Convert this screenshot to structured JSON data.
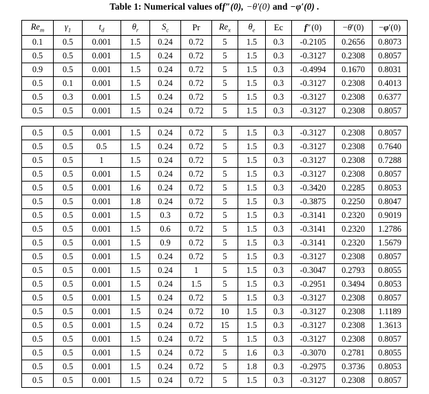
{
  "caption": {
    "lead": "Table 1: Numerical values of",
    "term1": "f″(0),",
    "term2": "−θ′(0)",
    "conj": "and",
    "term3": "−φ′(0) ."
  },
  "table": {
    "columns": [
      {
        "key": "Re_m",
        "base": "Re",
        "sub": "m",
        "style": "italic-sub"
      },
      {
        "key": "gamma1",
        "base": "γ",
        "sub": "1",
        "style": "italic-sub"
      },
      {
        "key": "t_d",
        "base": "t",
        "sub": "d",
        "style": "italic-sub"
      },
      {
        "key": "theta_r",
        "base": "θ",
        "sub": "r",
        "style": "italic-sub"
      },
      {
        "key": "S_c",
        "base": "S",
        "sub": "c",
        "style": "italic-sub"
      },
      {
        "key": "Pr",
        "base": "Pr",
        "sub": "",
        "style": "upright"
      },
      {
        "key": "Re_x",
        "base": "Re",
        "sub": "x",
        "style": "italic-sub"
      },
      {
        "key": "theta_e",
        "base": "θ",
        "sub": "e",
        "style": "italic-sub"
      },
      {
        "key": "Ec",
        "base": "Ec",
        "sub": "",
        "style": "upright"
      },
      {
        "key": "f2_0",
        "base": "f″(0)",
        "sub": "",
        "style": "math"
      },
      {
        "key": "mth_0",
        "base": "−θ′(0)",
        "sub": "",
        "style": "math"
      },
      {
        "key": "mph_0",
        "base": "−φ′(0)",
        "sub": "",
        "style": "math"
      }
    ],
    "header_labels": [
      "Re_m",
      "γ_1",
      "t_d",
      "θ_r",
      "S_c",
      "Pr",
      "Re_x",
      "θ_e",
      "Ec",
      "f″(0)",
      "−θ′(0)",
      "−φ′(0)"
    ],
    "block1_rows": [
      {
        "cells": [
          "0.1",
          "0.5",
          "0.001",
          "1.5",
          "0.24",
          "0.72",
          "5",
          "1.5",
          "0.3",
          "-0.2105",
          "0.2656",
          "0.8073"
        ],
        "align": [
          "c",
          "c",
          "c",
          "c",
          "c",
          "c",
          "c",
          "c",
          "c",
          "c",
          "c",
          "c"
        ]
      },
      {
        "cells": [
          "0.5",
          "0.5",
          "0.001",
          "1.5",
          "0.24",
          "0.72",
          "5",
          "1.5",
          "0.3",
          "-0.3127",
          "0.2308",
          "0.8057"
        ],
        "align": [
          "c",
          "c",
          "c",
          "c",
          "c",
          "c",
          "c",
          "c",
          "c",
          "c",
          "c",
          "c"
        ]
      },
      {
        "cells": [
          "0.9",
          "0.5",
          "0.001",
          "1.5",
          "0.24",
          "0.72",
          "5",
          "1.5",
          "0.3",
          "-0.4994",
          "0.1670",
          "0.8031"
        ],
        "align": [
          "c",
          "c",
          "c",
          "c",
          "c",
          "c",
          "c",
          "c",
          "c",
          "c",
          "c",
          "c"
        ]
      },
      {
        "cells": [
          "0.5",
          "0.1",
          "0.001",
          "1.5",
          "0.24",
          "0.72",
          "5",
          "1.5",
          "0.3",
          "-0.3127",
          "0.2308",
          "0.4013"
        ],
        "align": [
          "c",
          "c",
          "c",
          "c",
          "c",
          "c",
          "c",
          "c",
          "c",
          "c",
          "c",
          "c"
        ]
      },
      {
        "cells": [
          "0.5",
          "0.3",
          "0.001",
          "1.5",
          "0.24",
          "0.72",
          "5",
          "1.5",
          "0.3",
          "-0.3127",
          "0.2308",
          "0.6377"
        ],
        "align": [
          "c",
          "c",
          "c",
          "c",
          "c",
          "c",
          "c",
          "c",
          "c",
          "c",
          "c",
          "c"
        ]
      },
      {
        "cells": [
          "0.5",
          "0.5",
          "0.001",
          "1.5",
          "0.24",
          "0.72",
          "5",
          "1.5",
          "0.3",
          "-0.3127",
          "0.2308",
          "0.8057"
        ],
        "align": [
          "c",
          "c",
          "c",
          "c",
          "c",
          "c",
          "c",
          "c",
          "c",
          "c",
          "c",
          "c"
        ]
      }
    ],
    "block2_rows": [
      {
        "cells": [
          "0.5",
          "0.5",
          "0.001",
          "1.5",
          "0.24",
          "0.72",
          "5",
          "1.5",
          "0.3",
          "-0.3127",
          "0.2308",
          "0.8057"
        ],
        "align": [
          "c",
          "c",
          "c",
          "c",
          "c",
          "c",
          "c",
          "c",
          "c",
          "c",
          "c",
          "c"
        ]
      },
      {
        "cells": [
          "0.5",
          "0.5",
          "0.5",
          "1.5",
          "0.24",
          "0.72",
          "5",
          "1.5",
          "0.3",
          "-0.3127",
          "0.2308",
          "0.7640"
        ],
        "align": [
          "c",
          "c",
          "l",
          "c",
          "c",
          "c",
          "c",
          "c",
          "c",
          "c",
          "c",
          "c"
        ]
      },
      {
        "cells": [
          "0.5",
          "0.5",
          "1",
          "1.5",
          "0.24",
          "0.72",
          "5",
          "1.5",
          "0.3",
          "-0.3127",
          "0.2308",
          "0.7288"
        ],
        "align": [
          "c",
          "c",
          "l",
          "c",
          "c",
          "c",
          "c",
          "c",
          "c",
          "c",
          "c",
          "c"
        ]
      },
      {
        "cells": [
          "0.5",
          "0.5",
          "0.001",
          "1.5",
          "0.24",
          "0.72",
          "5",
          "1.5",
          "0.3",
          "-0.3127",
          "0.2308",
          "0.8057"
        ],
        "align": [
          "c",
          "c",
          "c",
          "c",
          "c",
          "c",
          "c",
          "c",
          "c",
          "c",
          "c",
          "c"
        ]
      },
      {
        "cells": [
          "0.5",
          "0.5",
          "0.001",
          "1.6",
          "0.24",
          "0.72",
          "5",
          "1.5",
          "0.3",
          "-0.3420",
          "0.2285",
          "0.8053"
        ],
        "align": [
          "c",
          "c",
          "c",
          "c",
          "c",
          "c",
          "c",
          "c",
          "c",
          "c",
          "c",
          "c"
        ]
      },
      {
        "cells": [
          "0.5",
          "0.5",
          "0.001",
          "1.8",
          "0.24",
          "0.72",
          "5",
          "1.5",
          "0.3",
          "-0.3875",
          "0.2250",
          "0.8047"
        ],
        "align": [
          "c",
          "c",
          "c",
          "c",
          "c",
          "c",
          "c",
          "c",
          "c",
          "c",
          "c",
          "c"
        ]
      },
      {
        "cells": [
          "0.5",
          "0.5",
          "0.001",
          "1.5",
          "0.3",
          "0.72",
          "5",
          "1.5",
          "0.3",
          "-0.3141",
          "0.2320",
          "0.9019"
        ],
        "align": [
          "c",
          "c",
          "c",
          "c",
          "c",
          "c",
          "c",
          "c",
          "c",
          "c",
          "c",
          "c"
        ]
      },
      {
        "cells": [
          "0.5",
          "0.5",
          "0.001",
          "1.5",
          "0.6",
          "0.72",
          "5",
          "1.5",
          "0.3",
          "-0.3141",
          "0.2320",
          "1.2786"
        ],
        "align": [
          "c",
          "c",
          "c",
          "c",
          "c",
          "c",
          "c",
          "c",
          "c",
          "c",
          "c",
          "c"
        ]
      },
      {
        "cells": [
          "0.5",
          "0.5",
          "0.001",
          "1.5",
          "0.9",
          "0.72",
          "5",
          "1.5",
          "0.3",
          "-0.3141",
          "0.2320",
          "1.5679"
        ],
        "align": [
          "c",
          "c",
          "c",
          "c",
          "c",
          "c",
          "c",
          "c",
          "c",
          "c",
          "c",
          "c"
        ]
      },
      {
        "cells": [
          "0.5",
          "0.5",
          "0.001",
          "1.5",
          "0.24",
          "0.72",
          "5",
          "1.5",
          "0.3",
          "-0.3127",
          "0.2308",
          "0.8057"
        ],
        "align": [
          "c",
          "c",
          "c",
          "c",
          "c",
          "c",
          "c",
          "c",
          "c",
          "c",
          "c",
          "c"
        ]
      },
      {
        "cells": [
          "0.5",
          "0.5",
          "0.001",
          "1.5",
          "0.24",
          "1",
          "5",
          "1.5",
          "0.3",
          "-0.3047",
          "0.2793",
          "0.8055"
        ],
        "align": [
          "c",
          "c",
          "c",
          "c",
          "c",
          "l",
          "c",
          "c",
          "c",
          "c",
          "c",
          "c"
        ]
      },
      {
        "cells": [
          "0.5",
          "0.5",
          "0.001",
          "1.5",
          "0.24",
          "1.5",
          "5",
          "1.5",
          "0.3",
          "-0.2951",
          "0.3494",
          "0.8053"
        ],
        "align": [
          "c",
          "c",
          "c",
          "c",
          "c",
          "l",
          "c",
          "c",
          "c",
          "c",
          "c",
          "c"
        ]
      },
      {
        "cells": [
          "0.5",
          "0.5",
          "0.001",
          "1.5",
          "0.24",
          "0.72",
          "5",
          "1.5",
          "0.3",
          "-0.3127",
          "0.2308",
          "0.8057"
        ],
        "align": [
          "c",
          "c",
          "c",
          "c",
          "c",
          "c",
          "c",
          "c",
          "c",
          "c",
          "c",
          "c"
        ]
      },
      {
        "cells": [
          "0.5",
          "0.5",
          "0.001",
          "1.5",
          "0.24",
          "0.72",
          "10",
          "1.5",
          "0.3",
          "-0.3127",
          "0.2308",
          "1.1189"
        ],
        "align": [
          "c",
          "c",
          "c",
          "c",
          "c",
          "c",
          "c",
          "c",
          "c",
          "c",
          "c",
          "c"
        ]
      },
      {
        "cells": [
          "0.5",
          "0.5",
          "0.001",
          "1.5",
          "0.24",
          "0.72",
          "15",
          "1.5",
          "0.3",
          "-0.3127",
          "0.2308",
          "1.3613"
        ],
        "align": [
          "c",
          "c",
          "c",
          "c",
          "c",
          "c",
          "c",
          "c",
          "c",
          "c",
          "c",
          "c"
        ]
      },
      {
        "cells": [
          "0.5",
          "0.5",
          "0.001",
          "1.5",
          "0.24",
          "0.72",
          "5",
          "1.5",
          "0.3",
          "-0.3127",
          "0.2308",
          "0.8057"
        ],
        "align": [
          "c",
          "c",
          "c",
          "c",
          "c",
          "c",
          "c",
          "c",
          "c",
          "c",
          "c",
          "c"
        ]
      },
      {
        "cells": [
          "0.5",
          "0.5",
          "0.001",
          "1.5",
          "0.24",
          "0.72",
          "5",
          "1.6",
          "0.3",
          "-0.3070",
          "0.2781",
          "0.8055"
        ],
        "align": [
          "c",
          "c",
          "c",
          "c",
          "c",
          "c",
          "c",
          "c",
          "c",
          "c",
          "c",
          "c"
        ]
      },
      {
        "cells": [
          "0.5",
          "0.5",
          "0.001",
          "1.5",
          "0.24",
          "0.72",
          "5",
          "1.8",
          "0.3",
          "-0.2975",
          "0.3736",
          "0.8053"
        ],
        "align": [
          "c",
          "c",
          "c",
          "c",
          "c",
          "c",
          "c",
          "c",
          "c",
          "c",
          "c",
          "c"
        ]
      },
      {
        "cells": [
          "0.5",
          "0.5",
          "0.001",
          "1.5",
          "0.24",
          "0.72",
          "5",
          "1.5",
          "0.3",
          "-0.3127",
          "0.2308",
          "0.8057"
        ],
        "align": [
          "c",
          "c",
          "c",
          "c",
          "c",
          "c",
          "c",
          "c",
          "c",
          "c",
          "c",
          "c"
        ]
      }
    ]
  },
  "colors": {
    "page_background": "#ffffff",
    "text": "#000000",
    "border": "#000000"
  }
}
